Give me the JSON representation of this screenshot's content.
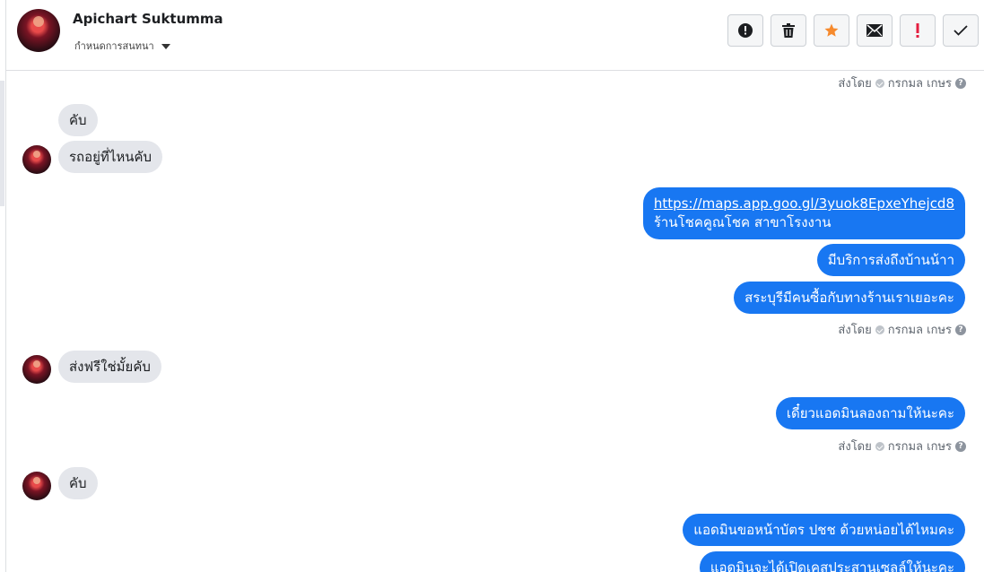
{
  "header": {
    "name": "Apichart Suktumma",
    "conversation_label": "กำหนดการสนทนา",
    "buttons": [
      {
        "icon": "alert-icon"
      },
      {
        "icon": "trash-icon"
      },
      {
        "icon": "star-icon"
      },
      {
        "icon": "envelope-icon"
      },
      {
        "icon": "important-icon"
      },
      {
        "icon": "checkmark-icon"
      }
    ]
  },
  "colors": {
    "outgoing_bubble": "#1877f2",
    "incoming_bubble": "#e4e6eb",
    "star": "#f68a2d",
    "important": "#e41e3f"
  },
  "messages": {
    "sent_by_label": "ส่งโดย",
    "sender_name": "กรกมล เกษร",
    "m1": "คับ",
    "m2": "รถอยู่ที่ไหนคับ",
    "m3_link": "https://maps.app.goo.gl/3yuok8EpxeYhejcd8",
    "m3_text": "ร้านโชคคูณโชค สาขาโรงงาน",
    "m4": "มีบริการส่งถึงบ้านน้าา",
    "m5": "สระบุรีมีคนซื้อกับทางร้านเราเยอะคะ",
    "m6": "ส่งฟรีใช่มั้ยคับ",
    "m7": "เดี๋ยวแอดมินลองถามให้นะคะ",
    "m8": "คับ",
    "m9": "แอดมินขอหน้าบัตร ปชช ด้วยหน่อยได้ไหมคะ",
    "m10": "แอดมินจะได้เปิดเคสประสานเซลล์ให้นะคะ"
  }
}
